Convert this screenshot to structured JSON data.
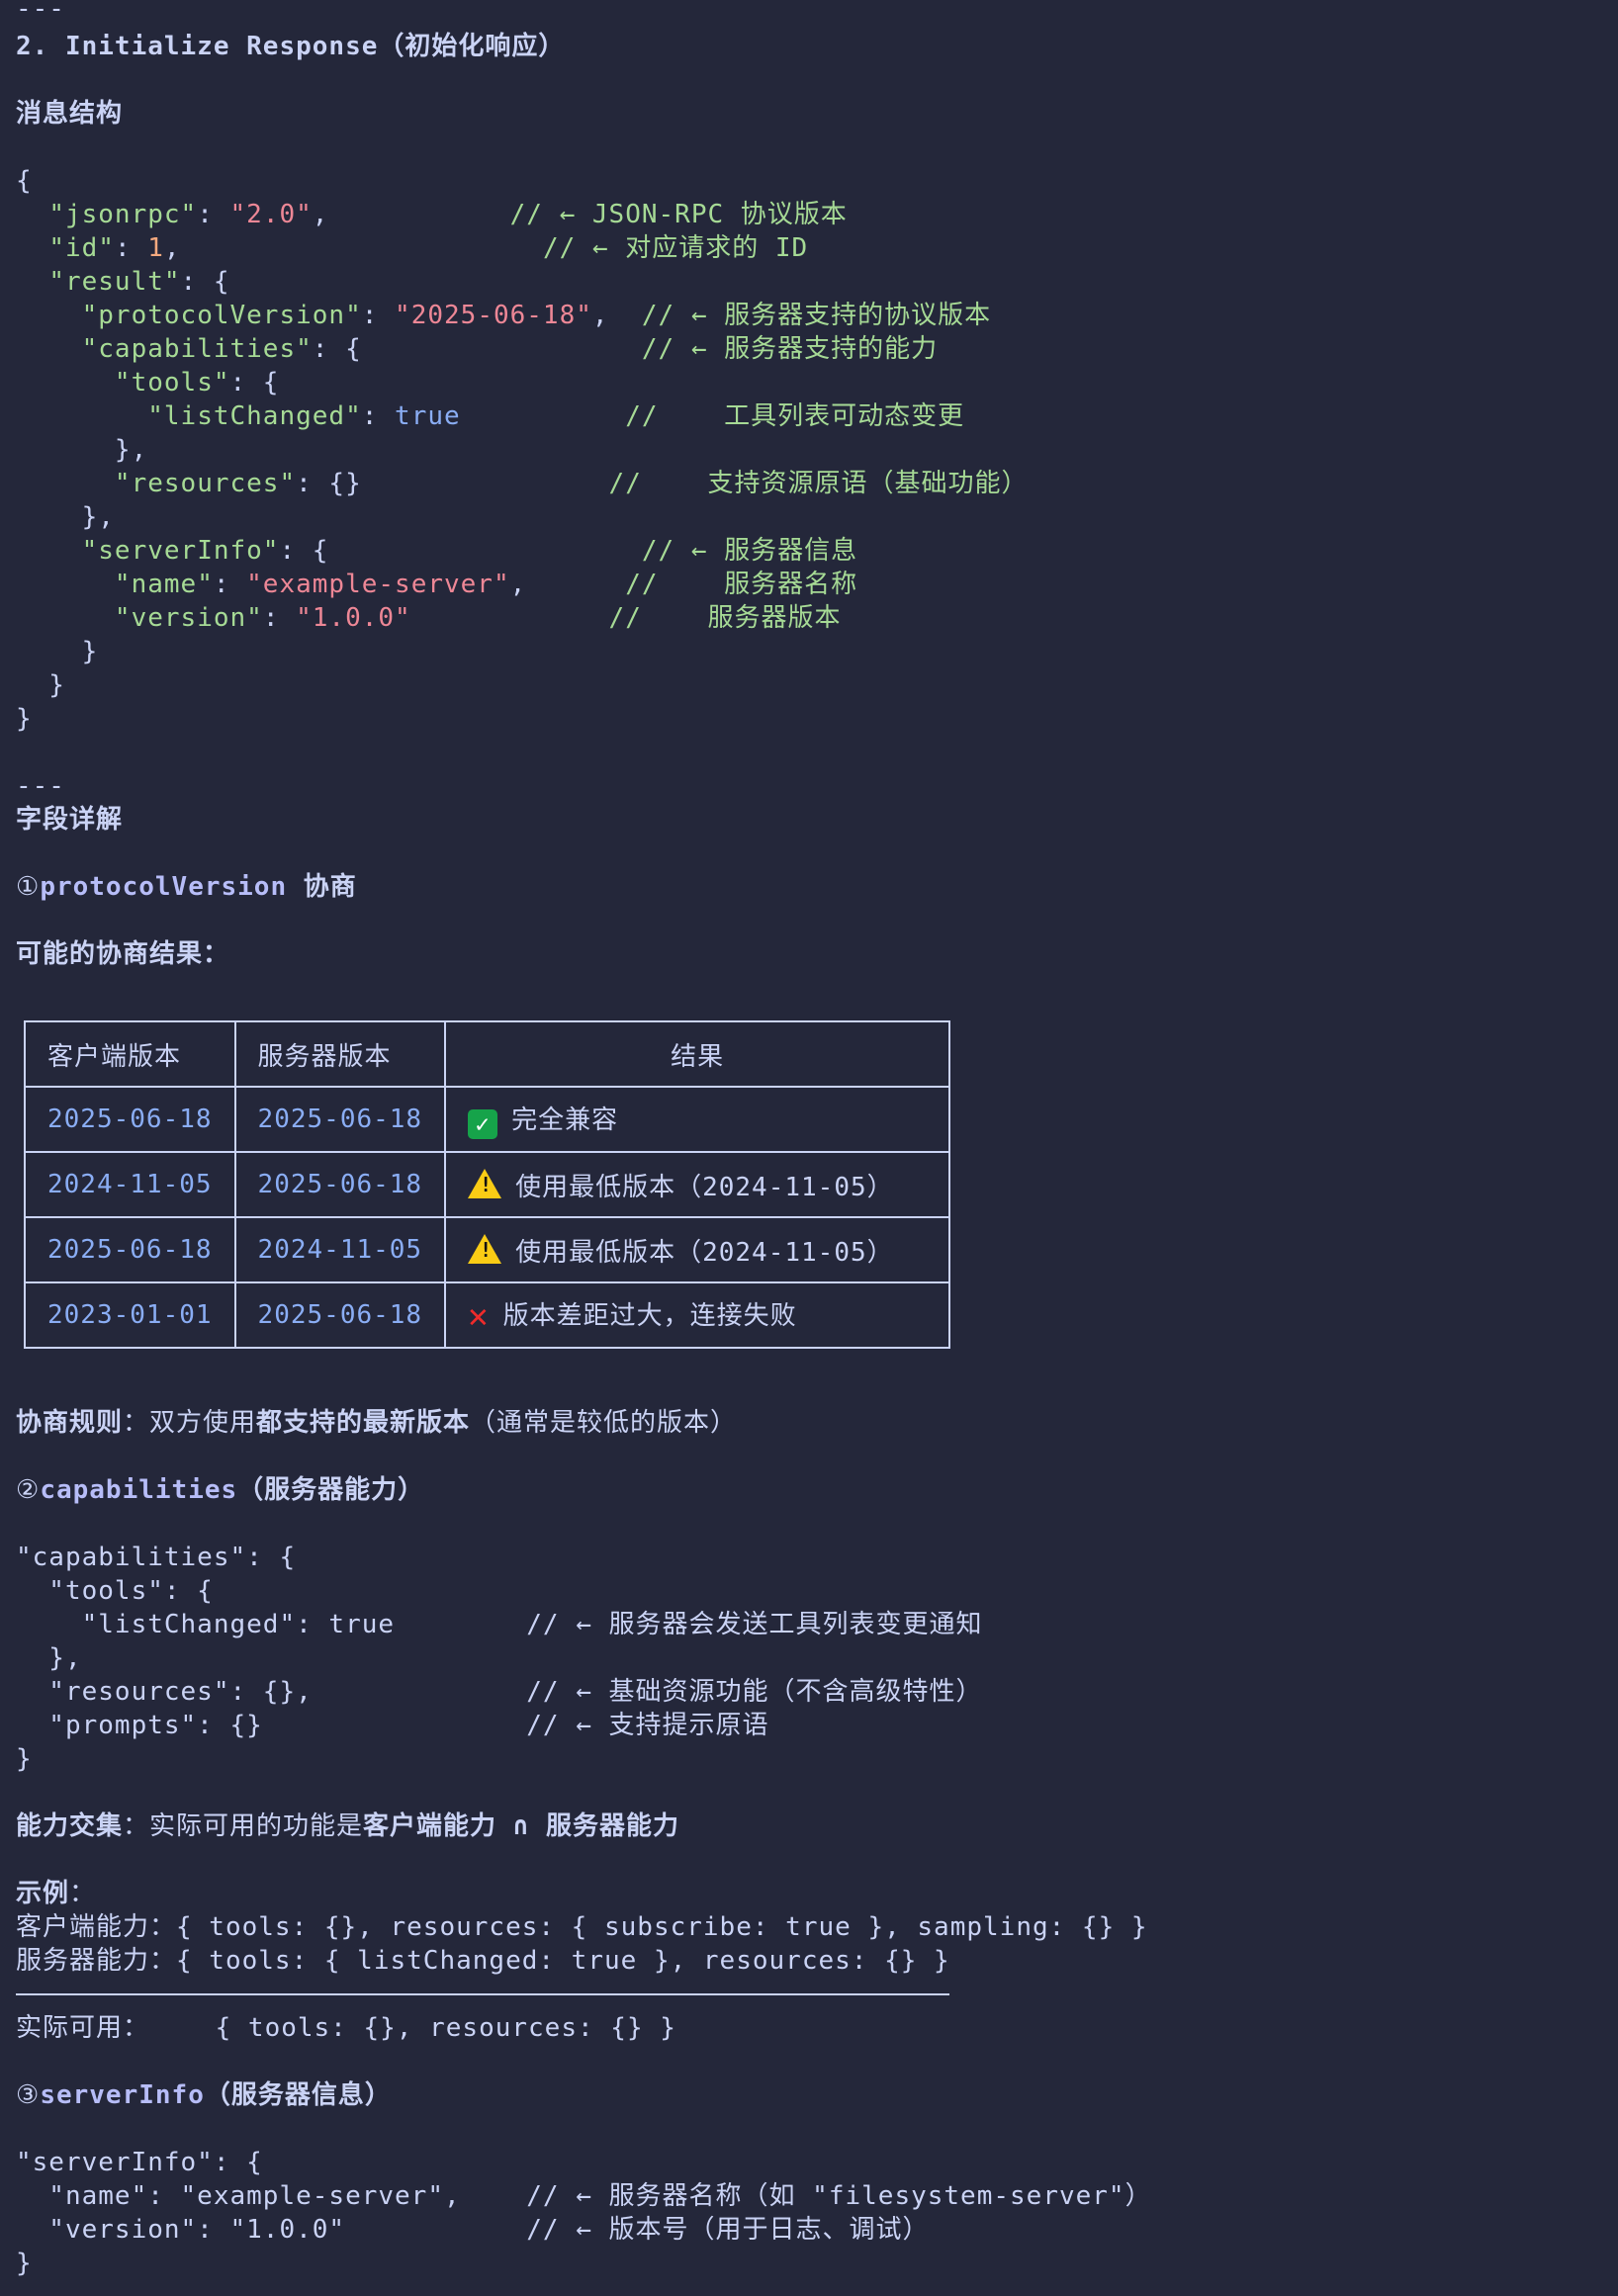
{
  "section_separator": "---",
  "section_title": "2. Initialize Response（初始化响应）",
  "message_structure_heading": "消息结构",
  "json_example": {
    "open_brace": "{",
    "jsonrpc_key": "\"jsonrpc\"",
    "jsonrpc_value": "\"2.0\"",
    "jsonrpc_comment": "// ← JSON-RPC 协议版本",
    "id_key": "\"id\"",
    "id_value": "1",
    "id_comment": "// ← 对应请求的 ID",
    "result_key": "\"result\"",
    "protocolVersion_key": "\"protocolVersion\"",
    "protocolVersion_value": "\"2025-06-18\"",
    "protocolVersion_comment": "// ← 服务器支持的协议版本",
    "capabilities_key": "\"capabilities\"",
    "capabilities_comment": "// ← 服务器支持的能力",
    "tools_key": "\"tools\"",
    "listChanged_key": "\"listChanged\"",
    "listChanged_value": "true",
    "listChanged_comment": "//    工具列表可动态变更",
    "resources_key": "\"resources\"",
    "resources_value": "{}",
    "resources_comment": "//    支持资源原语（基础功能）",
    "serverInfo_key": "\"serverInfo\"",
    "serverInfo_comment": "// ← 服务器信息",
    "name_key": "\"name\"",
    "name_value": "\"example-server\"",
    "name_comment": "//    服务器名称",
    "version_key": "\"version\"",
    "version_value": "\"1.0.0\"",
    "version_comment": "//    服务器版本",
    "close_brace": "}"
  },
  "fields_heading": "字段详解",
  "protocol_section": {
    "marker": "①",
    "title_code": "protocolVersion",
    "title_text": " 协商",
    "possible_results_label": "可能的协商结果：",
    "table_headers": [
      "客户端版本",
      "服务器版本",
      "结果"
    ],
    "table_rows": [
      {
        "client": "2025-06-18",
        "server": "2025-06-18",
        "icon": "check-mark-icon",
        "result": "完全兼容"
      },
      {
        "client": "2024-11-05",
        "server": "2025-06-18",
        "icon": "warning-icon",
        "result": "使用最低版本（2024-11-05）"
      },
      {
        "client": "2025-06-18",
        "server": "2024-11-05",
        "icon": "warning-icon",
        "result": "使用最低版本（2024-11-05）"
      },
      {
        "client": "2023-01-01",
        "server": "2025-06-18",
        "icon": "cross-mark-icon",
        "result": "版本差距过大，连接失败"
      }
    ],
    "rule_label": "协商规则",
    "rule_colon": "：双方使用",
    "rule_bold": "都支持的最新版本",
    "rule_tail": "（通常是较低的版本）"
  },
  "capabilities_section": {
    "marker": "②",
    "title_code": "capabilities",
    "title_text": "（服务器能力）",
    "code_lines": [
      "\"capabilities\": {",
      "  \"tools\": {",
      "    \"listChanged\": true        // ← 服务器会发送工具列表变更通知",
      "  },",
      "  \"resources\": {},             // ← 基础资源功能（不含高级特性）",
      "  \"prompts\": {}                // ← 支持提示原语",
      "}"
    ],
    "intersection_label": "能力交集",
    "intersection_text": "：实际可用的功能是",
    "intersection_bold": "客户端能力 ∩ 服务器能力",
    "example_label": "示例",
    "example_colon": "：",
    "client_line": "客户端能力：{ tools: {}, resources: { subscribe: true }, sampling: {} }",
    "server_line": "服务器能力：{ tools: { listChanged: true }, resources: {} }",
    "actual_line": "实际可用：    { tools: {}, resources: {} }"
  },
  "serverinfo_section": {
    "marker": "③",
    "title_code": "serverInfo",
    "title_text": "（服务器信息）",
    "code_lines": [
      "\"serverInfo\": {",
      "  \"name\": \"example-server\",    // ← 服务器名称（如 \"filesystem-server\"）",
      "  \"version\": \"1.0.0\"           // ← 版本号（用于日志、调试）",
      "}"
    ]
  }
}
